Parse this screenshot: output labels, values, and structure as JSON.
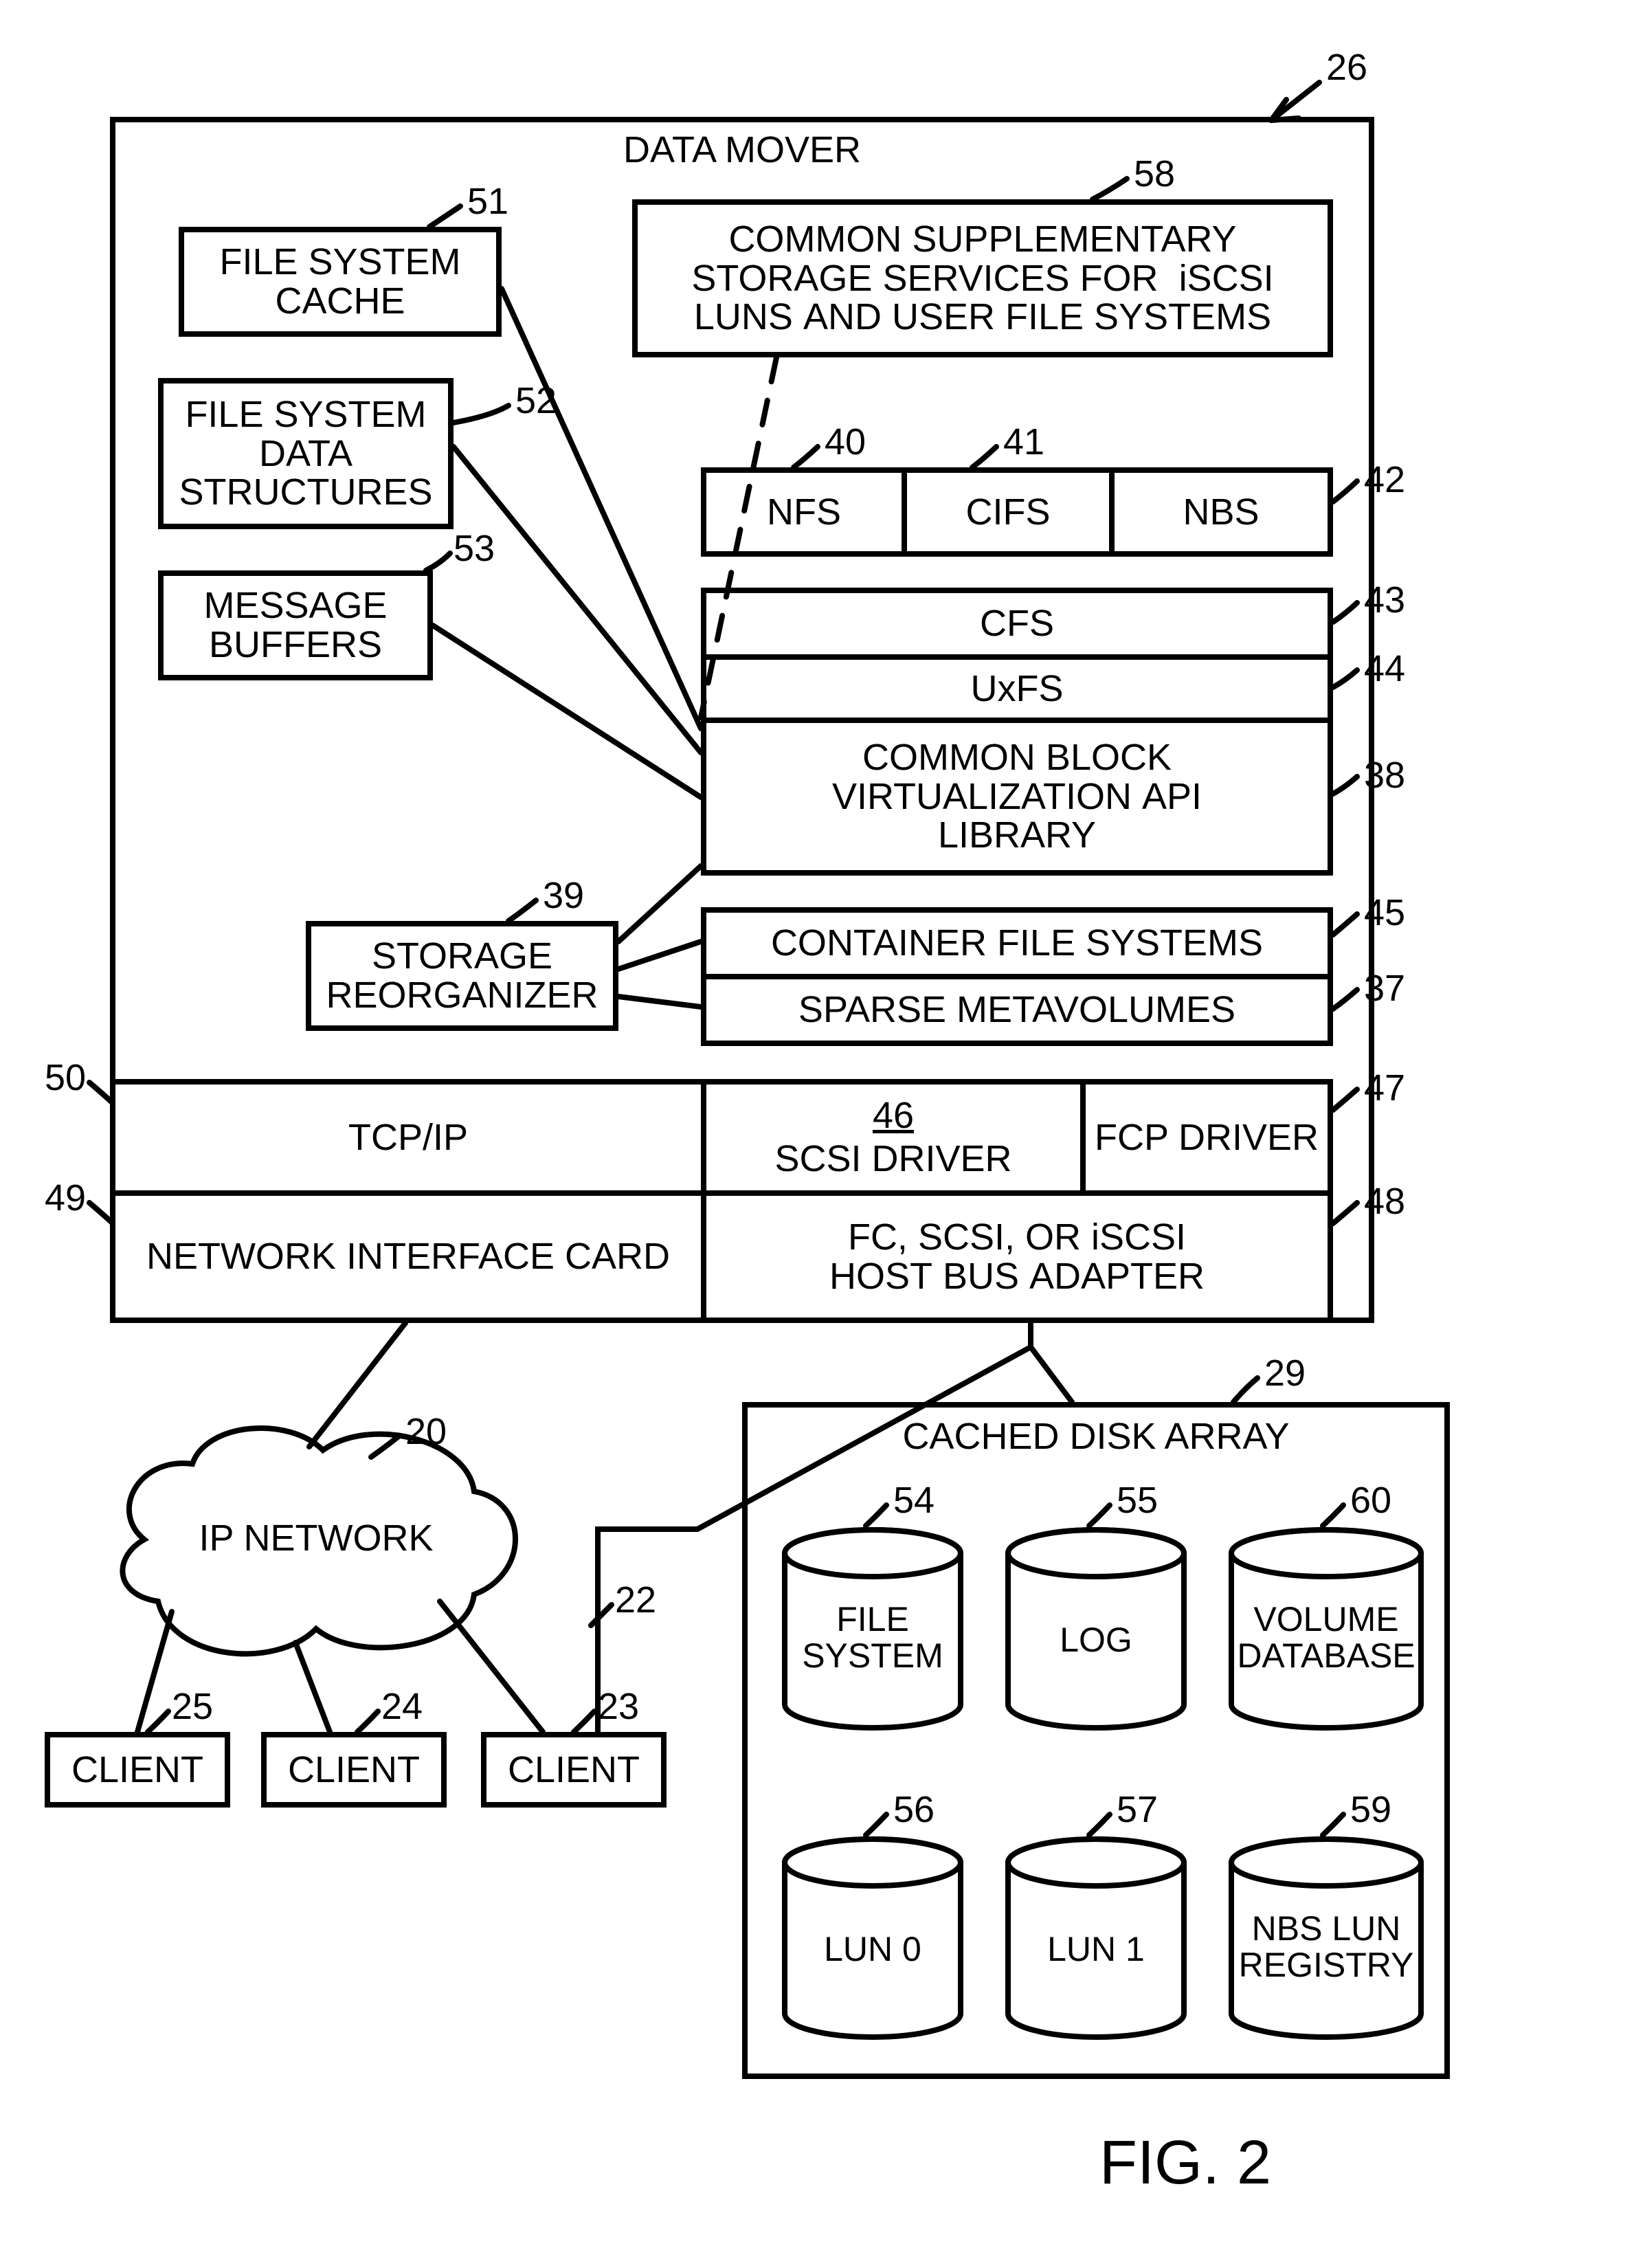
{
  "fig": "FIG. 2",
  "dataMover": {
    "title": "DATA MOVER",
    "fsCache": "FILE SYSTEM\nCACHE",
    "fsData": "FILE SYSTEM\nDATA\nSTRUCTURES",
    "msgBuf": "MESSAGE\nBUFFERS",
    "storageReorg": "STORAGE\nREORGANIZER",
    "commonSupp": "COMMON SUPPLEMENTARY\nSTORAGE SERVICES FOR  iSCSI\nLUNS AND USER FILE SYSTEMS",
    "nfs": "NFS",
    "cifs": "CIFS",
    "nbs": "NBS",
    "cfs": "CFS",
    "uxfs": "UxFS",
    "cbvl": "COMMON BLOCK\nVIRTUALIZATION API\nLIBRARY",
    "containerFS": "CONTAINER FILE SYSTEMS",
    "sparseMV": "SPARSE METAVOLUMES",
    "scsiDriver": "SCSI DRIVER",
    "scsiRef": "46",
    "fcpDriver": "FCP DRIVER",
    "tcpip": "TCP/IP",
    "nic": "NETWORK INTERFACE CARD",
    "hba": "FC, SCSI, OR iSCSI\nHOST BUS ADAPTER"
  },
  "ipNetwork": "IP NETWORK",
  "clients": [
    "CLIENT",
    "CLIENT",
    "CLIENT"
  ],
  "cachedDiskArray": {
    "title": "CACHED DISK ARRAY",
    "fs": "FILE\nSYSTEM",
    "log": "LOG",
    "voldb": "VOLUME\nDATABASE",
    "lun0": "LUN 0",
    "lun1": "LUN 1",
    "nbsreg": "NBS LUN\nREGISTRY"
  },
  "refs": {
    "r26": "26",
    "r51": "51",
    "r52": "52",
    "r53": "53",
    "r39": "39",
    "r58": "58",
    "r40": "40",
    "r41": "41",
    "r42": "42",
    "r43": "43",
    "r44": "44",
    "r38": "38",
    "r45": "45",
    "r37": "37",
    "r46": "46",
    "r47": "47",
    "r48": "48",
    "r50": "50",
    "r49": "49",
    "r20": "20",
    "r22": "22",
    "r23": "23",
    "r24": "24",
    "r25": "25",
    "r29": "29",
    "r54": "54",
    "r55": "55",
    "r60": "60",
    "r56": "56",
    "r57": "57",
    "r59": "59"
  },
  "chart_data": {
    "type": "diagram",
    "nodes": [
      {
        "id": 26,
        "label": "DATA MOVER",
        "contains": [
          51,
          52,
          53,
          39,
          58,
          40,
          41,
          42,
          43,
          44,
          38,
          45,
          37,
          46,
          47,
          48,
          49,
          50
        ]
      },
      {
        "id": 51,
        "label": "FILE SYSTEM CACHE"
      },
      {
        "id": 52,
        "label": "FILE SYSTEM DATA STRUCTURES"
      },
      {
        "id": 53,
        "label": "MESSAGE BUFFERS"
      },
      {
        "id": 39,
        "label": "STORAGE REORGANIZER"
      },
      {
        "id": 58,
        "label": "COMMON SUPPLEMENTARY STORAGE SERVICES FOR iSCSI LUNS AND USER FILE SYSTEMS"
      },
      {
        "id": 40,
        "label": "NFS"
      },
      {
        "id": 41,
        "label": "CIFS"
      },
      {
        "id": 42,
        "label": "NBS"
      },
      {
        "id": 43,
        "label": "CFS"
      },
      {
        "id": 44,
        "label": "UxFS"
      },
      {
        "id": 38,
        "label": "COMMON BLOCK VIRTUALIZATION API LIBRARY"
      },
      {
        "id": 45,
        "label": "CONTAINER FILE SYSTEMS"
      },
      {
        "id": 37,
        "label": "SPARSE METAVOLUMES"
      },
      {
        "id": 46,
        "label": "SCSI DRIVER"
      },
      {
        "id": 47,
        "label": "FCP DRIVER"
      },
      {
        "id": 50,
        "label": "TCP/IP"
      },
      {
        "id": 49,
        "label": "NETWORK INTERFACE CARD"
      },
      {
        "id": 48,
        "label": "FC, SCSI, OR iSCSI HOST BUS ADAPTER"
      },
      {
        "id": 20,
        "label": "IP NETWORK"
      },
      {
        "id": 22,
        "label": "(connection to client 23)"
      },
      {
        "id": 23,
        "label": "CLIENT"
      },
      {
        "id": 24,
        "label": "CLIENT"
      },
      {
        "id": 25,
        "label": "CLIENT"
      },
      {
        "id": 29,
        "label": "CACHED DISK ARRAY",
        "contains": [
          54,
          55,
          60,
          56,
          57,
          59
        ]
      },
      {
        "id": 54,
        "label": "FILE SYSTEM",
        "shape": "cylinder"
      },
      {
        "id": 55,
        "label": "LOG",
        "shape": "cylinder"
      },
      {
        "id": 60,
        "label": "VOLUME DATABASE",
        "shape": "cylinder"
      },
      {
        "id": 56,
        "label": "LUN 0",
        "shape": "cylinder"
      },
      {
        "id": 57,
        "label": "LUN 1",
        "shape": "cylinder"
      },
      {
        "id": 59,
        "label": "NBS LUN REGISTRY",
        "shape": "cylinder"
      }
    ],
    "edges": [
      {
        "from": 51,
        "to": 38
      },
      {
        "from": 52,
        "to": 38
      },
      {
        "from": 53,
        "to": 38
      },
      {
        "from": 58,
        "to": 38,
        "style": "dashed"
      },
      {
        "from": 39,
        "to": 38
      },
      {
        "from": 39,
        "to": 45
      },
      {
        "from": 39,
        "to": 37
      },
      {
        "from": 49,
        "to": 20
      },
      {
        "from": 20,
        "to": 25
      },
      {
        "from": 20,
        "to": 24
      },
      {
        "from": 20,
        "to": 23
      },
      {
        "from": 48,
        "to": 23
      },
      {
        "from": 48,
        "to": 29
      }
    ]
  }
}
